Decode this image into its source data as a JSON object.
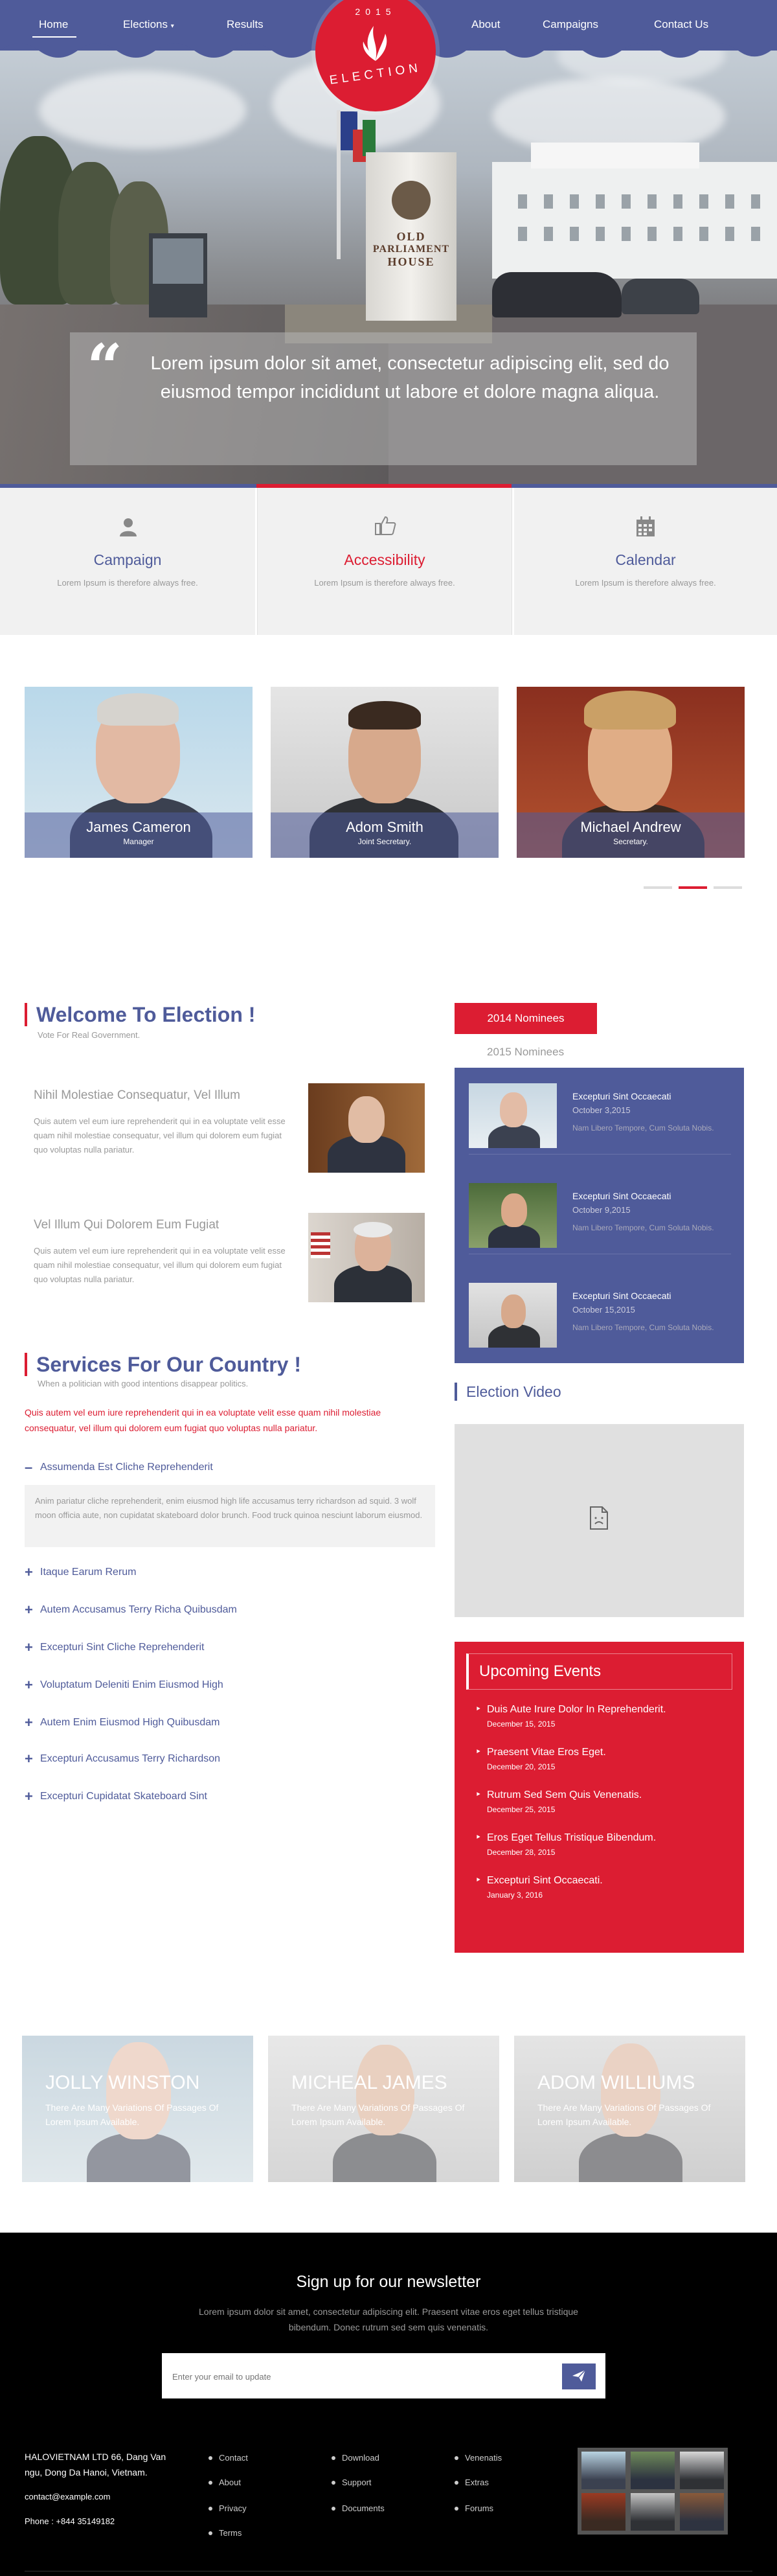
{
  "nav": {
    "items": [
      "Home",
      "Elections",
      "Results",
      "About",
      "Campaigns",
      "Contact Us"
    ],
    "logo_year": "2015",
    "logo_text": "ELECTION"
  },
  "hero": {
    "sign": [
      "OLD",
      "PARLIAMENT",
      "HOUSE"
    ],
    "quote": "Lorem ipsum dolor sit amet, consectetur adipiscing elit, sed do eiusmod tempor incididunt ut labore et dolore magna aliqua."
  },
  "features": [
    {
      "title": "Campaign",
      "text": "Lorem Ipsum is therefore always free.",
      "icon": "user-icon"
    },
    {
      "title": "Accessibility",
      "text": "Lorem Ipsum is therefore always free.",
      "icon": "thumbs-up-icon"
    },
    {
      "title": "Calendar",
      "text": "Lorem Ipsum is therefore always free.",
      "icon": "calendar-icon"
    }
  ],
  "team": [
    {
      "name": "James Cameron",
      "role": "Manager"
    },
    {
      "name": "Adom Smith",
      "role": "Joint Secretary."
    },
    {
      "name": "Michael Andrew",
      "role": "Secretary."
    }
  ],
  "welcome": {
    "title": "Welcome To Election !",
    "subtitle": "Vote For Real Government.",
    "posts": [
      {
        "title": "Nihil Molestiae Consequatur, Vel Illum",
        "text": "Quis autem vel eum iure reprehenderit qui in ea voluptate velit esse quam nihil molestiae consequatur, vel illum qui dolorem eum fugiat quo voluptas nulla pariatur."
      },
      {
        "title": "Vel Illum Qui Dolorem Eum Fugiat",
        "text": "Quis autem vel eum iure reprehenderit qui in ea voluptate velit esse quam nihil molestiae consequatur, vel illum qui dolorem eum fugiat quo voluptas nulla pariatur."
      }
    ]
  },
  "nominees": {
    "tab1": "2014 Nominees",
    "tab2": "2015 Nominees",
    "items": [
      {
        "title": "Excepturi Sint Occaecati",
        "date": "October 3,2015",
        "text": "Nam Libero Tempore, Cum Soluta Nobis."
      },
      {
        "title": "Excepturi Sint Occaecati",
        "date": "October 9,2015",
        "text": "Nam Libero Tempore, Cum Soluta Nobis."
      },
      {
        "title": "Excepturi Sint Occaecati",
        "date": "October 15,2015",
        "text": "Nam Libero Tempore, Cum Soluta Nobis."
      }
    ]
  },
  "services": {
    "title": "Services For Our Country !",
    "subtitle": "When a politician with good intentions disappear politics.",
    "lead": "Quis autem vel eum iure reprehenderit qui in ea voluptate velit esse quam nihil molestiae consequatur, vel illum qui dolorem eum fugiat quo voluptas nulla pariatur.",
    "open_item": "Assumenda Est Cliche Reprehenderit",
    "open_text": "Anim pariatur cliche reprehenderit, enim eiusmod high life accusamus terry richardson ad squid. 3 wolf moon officia aute, non cupidatat skateboard dolor brunch. Food truck quinoa nesciunt laborum eiusmod.",
    "items": [
      "Itaque Earum Rerum",
      "Autem Accusamus Terry Richa Quibusdam",
      "Excepturi Sint Cliche Reprehenderit",
      "Voluptatum Deleniti Enim Eiusmod High",
      "Autem Enim Eiusmod High Quibusdam",
      "Excepturi Accusamus Terry Richardson",
      "Excepturi Cupidatat Skateboard Sint"
    ]
  },
  "video": {
    "title": "Election Video"
  },
  "events": {
    "title": "Upcoming Events",
    "items": [
      {
        "title": "Duis Aute Irure Dolor In Reprehenderit.",
        "date": "December 15, 2015"
      },
      {
        "title": "Praesent Vitae Eros Eget.",
        "date": "December 20, 2015"
      },
      {
        "title": "Rutrum Sed Sem Quis Venenatis.",
        "date": "December 25, 2015"
      },
      {
        "title": "Eros Eget Tellus Tristique Bibendum.",
        "date": "December 28, 2015"
      },
      {
        "title": "Excepturi Sint Occaecati.",
        "date": "January 3, 2016"
      }
    ]
  },
  "candidates": [
    {
      "name": "JOLLY WINSTON",
      "text": "There Are Many Variations Of Passages Of Lorem Ipsum Available."
    },
    {
      "name": "MICHEAL JAMES",
      "text": "There Are Many Variations Of Passages Of Lorem Ipsum Available."
    },
    {
      "name": "ADOM WILLIUMS",
      "text": "There Are Many Variations Of Passages Of Lorem Ipsum Available."
    }
  ],
  "newsletter": {
    "title": "Sign up for our newsletter",
    "text": "Lorem ipsum dolor sit amet, consectetur adipiscing elit. Praesent vitae eros eget tellus tristique bibendum. Donec rutrum sed sem quis venenatis.",
    "placeholder": "Enter your email to update"
  },
  "footer": {
    "address": [
      "HALOVIETNAM LTD 66, Dang Van",
      "ngu, Dong Da Hanoi, Vietnam."
    ],
    "email": "contact@example.com",
    "phone": "Phone : +844 35149182",
    "col1": [
      "Contact",
      "About",
      "Privacy",
      "Terms"
    ],
    "col2": [
      "Download",
      "Support",
      "Documents"
    ],
    "col3": [
      "Venenatis",
      "Extras",
      "Forums"
    ]
  },
  "colors": {
    "brand": "#4f5b9a",
    "accent": "#dc1d32"
  }
}
